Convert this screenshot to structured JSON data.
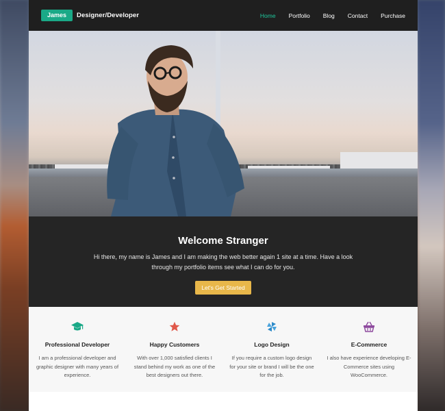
{
  "brand": {
    "name": "James",
    "tagline": "Designer/Developer",
    "accent": "#1aa987"
  },
  "nav": {
    "items": [
      {
        "label": "Home",
        "active": true
      },
      {
        "label": "Portfolio",
        "active": false
      },
      {
        "label": "Blog",
        "active": false
      },
      {
        "label": "Contact",
        "active": false
      },
      {
        "label": "Purchase",
        "active": false
      }
    ],
    "active_color": "#1fc79c"
  },
  "welcome": {
    "title": "Welcome Stranger",
    "text": "Hi there, my name is James and I am making the web better again 1 site at a time. Have a look through my portfolio items see what I can do for you.",
    "button_label": "Let's Get Started",
    "button_color": "#e8b74a"
  },
  "features": [
    {
      "icon": "graduation-cap-icon",
      "icon_color": "#1aa987",
      "title": "Professional Developer",
      "text": "I am a professional developer and graphic designer with many years of experience."
    },
    {
      "icon": "star-icon",
      "icon_color": "#e0584a",
      "title": "Happy Customers",
      "text": "With over 1,000 satisfied clients I stand behind my work as one of the best designers out there."
    },
    {
      "icon": "pinwheel-icon",
      "icon_color": "#2d8ac9",
      "title": "Logo Design",
      "text": "If you require a custom logo design for your site or brand I will be the one for the job."
    },
    {
      "icon": "basket-icon",
      "icon_color": "#8e4a9e",
      "title": "E-Commerce",
      "text": "I also have experience developing E-Commerce sites using WooCommerce."
    }
  ]
}
